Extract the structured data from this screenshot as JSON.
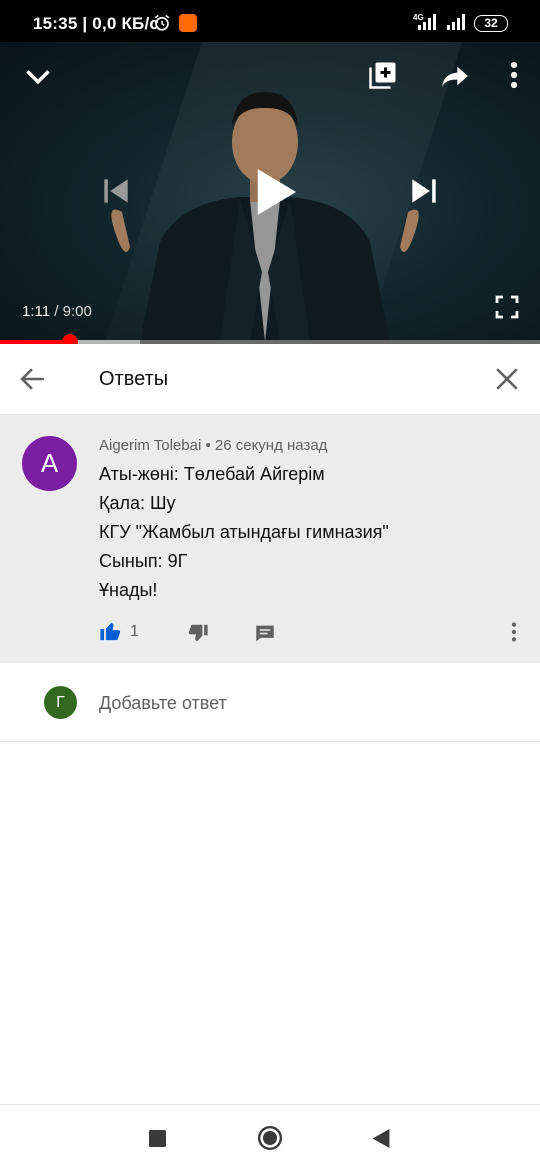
{
  "status_bar": {
    "time": "15:35",
    "speed": "0,0 КБ/с",
    "network": "4G",
    "battery": "32",
    "icons": [
      "alarm-icon",
      "app-notification-icon",
      "signal-icon",
      "battery-icon"
    ]
  },
  "video": {
    "current_time": "1:11",
    "separator": " / ",
    "duration": "9:00",
    "progress_fraction": 0.13,
    "buffer_fraction": 0.26,
    "controls": [
      "collapse-icon",
      "add-to-playlist-icon",
      "share-icon",
      "more-icon",
      "previous-icon",
      "play-icon",
      "next-icon",
      "fullscreen-icon"
    ]
  },
  "replies": {
    "title": "Ответы"
  },
  "comment": {
    "avatar_letter": "A",
    "author": "Aigerim Tolebai",
    "time": "26 секунд назад",
    "lines": [
      "Аты-жөні: Төлебай Айгерім",
      "Қала: Шу",
      "КГУ \"Жамбыл атындағы гимназия\"",
      "Сынып: 9Г",
      "Ұнады!"
    ],
    "likes": "1",
    "avatar_color": "#7b1fa2",
    "like_color": "#065fd4"
  },
  "add_reply": {
    "avatar_letter": "Г",
    "placeholder": "Добавьте ответ",
    "avatar_color": "#33691e"
  },
  "accent_color": "#ff0000"
}
